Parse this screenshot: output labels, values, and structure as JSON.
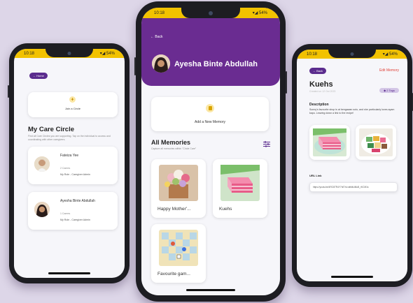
{
  "left": {
    "status": {
      "time": "10:18",
      "icons": "▾◢ 54%"
    },
    "back_label": "Home",
    "join_label": "Join a Circle",
    "section_title": "My Care Circle",
    "section_desc": "Find all Care Circles you are supporting. Tap on the individual to access and coordinating with other caregivers.",
    "members": [
      {
        "name": "Fateiza Yee",
        "count": "2 Carees",
        "role": "My Role - Caregiver Admin"
      },
      {
        "name": "Ayesha Binte Abdullah",
        "count": "1 Carees",
        "role": "My Role - Caregiver Admin"
      }
    ]
  },
  "center": {
    "status": {
      "time": "10:18",
      "icons": "▾◢ 54%"
    },
    "back_label": "Back",
    "profile_name": "Ayesha Binte Abdullah",
    "add_label": "Add a New Memory",
    "section_title": "All Memories",
    "section_desc": "Capture all memories within \"Circle Care\"",
    "memories": [
      {
        "title": "Happy Mother'..."
      },
      {
        "title": "Kuehs"
      },
      {
        "title": "Favourite gam..."
      }
    ],
    "colors": {
      "header": "#6a2c91",
      "status": "#f2c200"
    }
  },
  "right": {
    "status": {
      "time": "10:18",
      "icons": "▾◢ 54%"
    },
    "back_label": "Back",
    "edit_label": "Edit Memory",
    "title": "Kuehs",
    "subtitle": "Created on 12 Oct 2023",
    "tag_label": "2 Tags",
    "desc_heading": "Description",
    "desc_text": "Sunny's favourite shop is at bengawan solo, and she particularly loves ayam kapu. Leaving down a link to the recipe!",
    "url_heading": "URL Link",
    "url_value": "https://youtu.be/4RC6TR4Y7nE?si=atfdkUl6uB_rKCM1s"
  }
}
